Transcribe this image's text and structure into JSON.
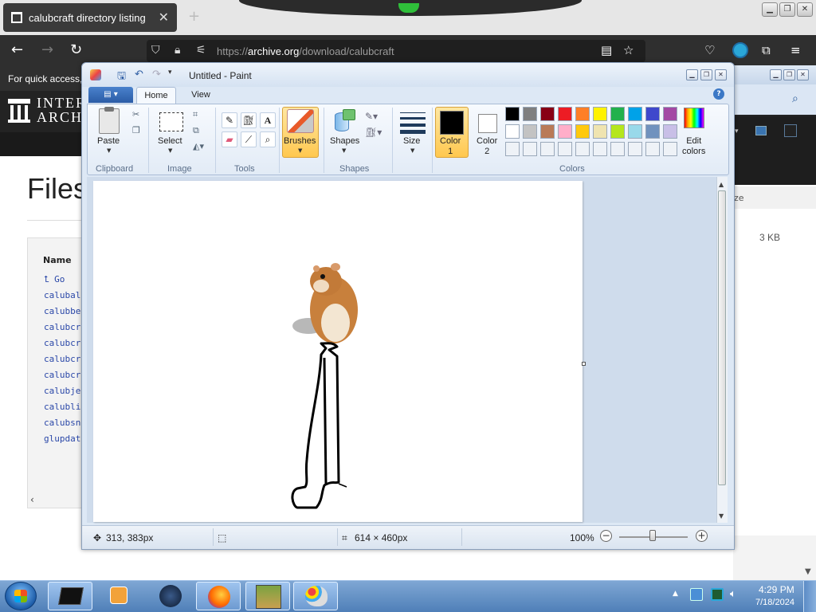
{
  "browser": {
    "tab_title": "calubcraft directory listing",
    "new_tab": "+",
    "tab_close": "✕",
    "url_prefix": "https://",
    "url_host": "archive.org",
    "url_path": "/download/calubcraft",
    "bookmarks_text": "For quick access,",
    "logo_line1": "INTER",
    "logo_line2": "ARCHI"
  },
  "page": {
    "title": "Files",
    "column_name": "Name",
    "go_up": "Go",
    "files": [
      "calubal",
      "calubbe",
      "calubcr",
      "calubcr",
      "calubcr",
      "calubcr",
      "calubje",
      "calubli",
      "calubsn",
      "glupdat"
    ],
    "size_label": "ze",
    "size_value": "3 KB"
  },
  "paint": {
    "title": "Untitled - Paint",
    "tabs": {
      "home": "Home",
      "view": "View"
    },
    "buttons": {
      "paste": "Paste",
      "select": "Select",
      "brushes": "Brushes",
      "shapes": "Shapes",
      "size": "Size",
      "color1_line1": "Color",
      "color1_line2": "1",
      "color2_line1": "Color",
      "color2_line2": "2",
      "edit_colors_line1": "Edit",
      "edit_colors_line2": "colors"
    },
    "groups": {
      "clipboard": "Clipboard",
      "image": "Image",
      "tools": "Tools",
      "shapes": "Shapes",
      "colors": "Colors"
    },
    "palette_row1": [
      "#000000",
      "#7f7f7f",
      "#880015",
      "#ed1c24",
      "#ff7f27",
      "#fff200",
      "#22b14c",
      "#00a2e8",
      "#3f48cc",
      "#a349a4"
    ],
    "palette_row2": [
      "#ffffff",
      "#c3c3c3",
      "#b97a57",
      "#ffaec9",
      "#ffc90e",
      "#efe4b0",
      "#b5e61d",
      "#99d9ea",
      "#7092be",
      "#c8bfe7"
    ],
    "palette_row3_count": 10,
    "status": {
      "cursor_pos": "313, 383px",
      "canvas_size": "614 × 460px",
      "zoom": "100%"
    }
  },
  "taskbar": {
    "time": "4:29 PM",
    "date": "7/18/2024"
  }
}
